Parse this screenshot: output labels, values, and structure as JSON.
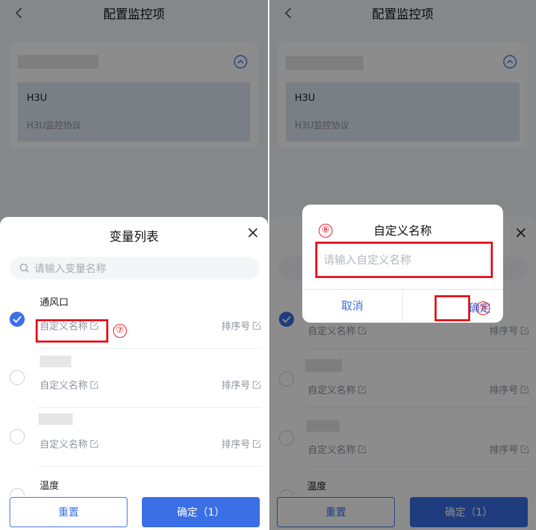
{
  "left": {
    "header": {
      "title": "配置监控项"
    },
    "protocol": {
      "name": "H3U",
      "description": "H3U监控协议"
    },
    "sheet": {
      "title": "变量列表",
      "search_placeholder": "请输入变量名称",
      "items": [
        {
          "name": "通风口",
          "custom_label": "自定义名称",
          "sort_label": "排序号",
          "checked": true
        },
        {
          "name": "",
          "custom_label": "自定义名称",
          "sort_label": "排序号",
          "checked": false
        },
        {
          "name": "",
          "custom_label": "自定义名称",
          "sort_label": "排序号",
          "checked": false
        },
        {
          "name": "温度",
          "custom_label": "",
          "sort_label": "",
          "checked": false
        }
      ],
      "reset_label": "重置",
      "confirm_label": "确定（1）"
    },
    "annotation": {
      "marker": "⑦"
    }
  },
  "right": {
    "header": {
      "title": "配置监控项"
    },
    "protocol": {
      "name": "H3U",
      "description": "H3U监控协议"
    },
    "sheet": {
      "search_placeholder": "",
      "items": [
        {
          "name": "",
          "custom_label": "自定义名称",
          "sort_label": "排序号",
          "checked": true
        },
        {
          "name": "",
          "custom_label": "自定义名称",
          "sort_label": "排序号",
          "checked": false
        },
        {
          "name": "",
          "custom_label": "自定义名称",
          "sort_label": "排序号",
          "checked": false
        },
        {
          "name": "温度",
          "custom_label": "",
          "sort_label": "",
          "checked": false
        }
      ],
      "reset_label": "重置",
      "confirm_label": "确定（1）"
    },
    "dialog": {
      "title": "自定义名称",
      "input_placeholder": "请输入自定义名称",
      "cancel_label": "取消",
      "ok_label": "确定"
    },
    "annotation": {
      "marker_input": "⑧",
      "marker_ok": "⑨"
    }
  },
  "colors": {
    "accent": "#3a6fe6",
    "annotation": "#e3141d",
    "overlay": "rgba(0,0,0,0.45)"
  }
}
